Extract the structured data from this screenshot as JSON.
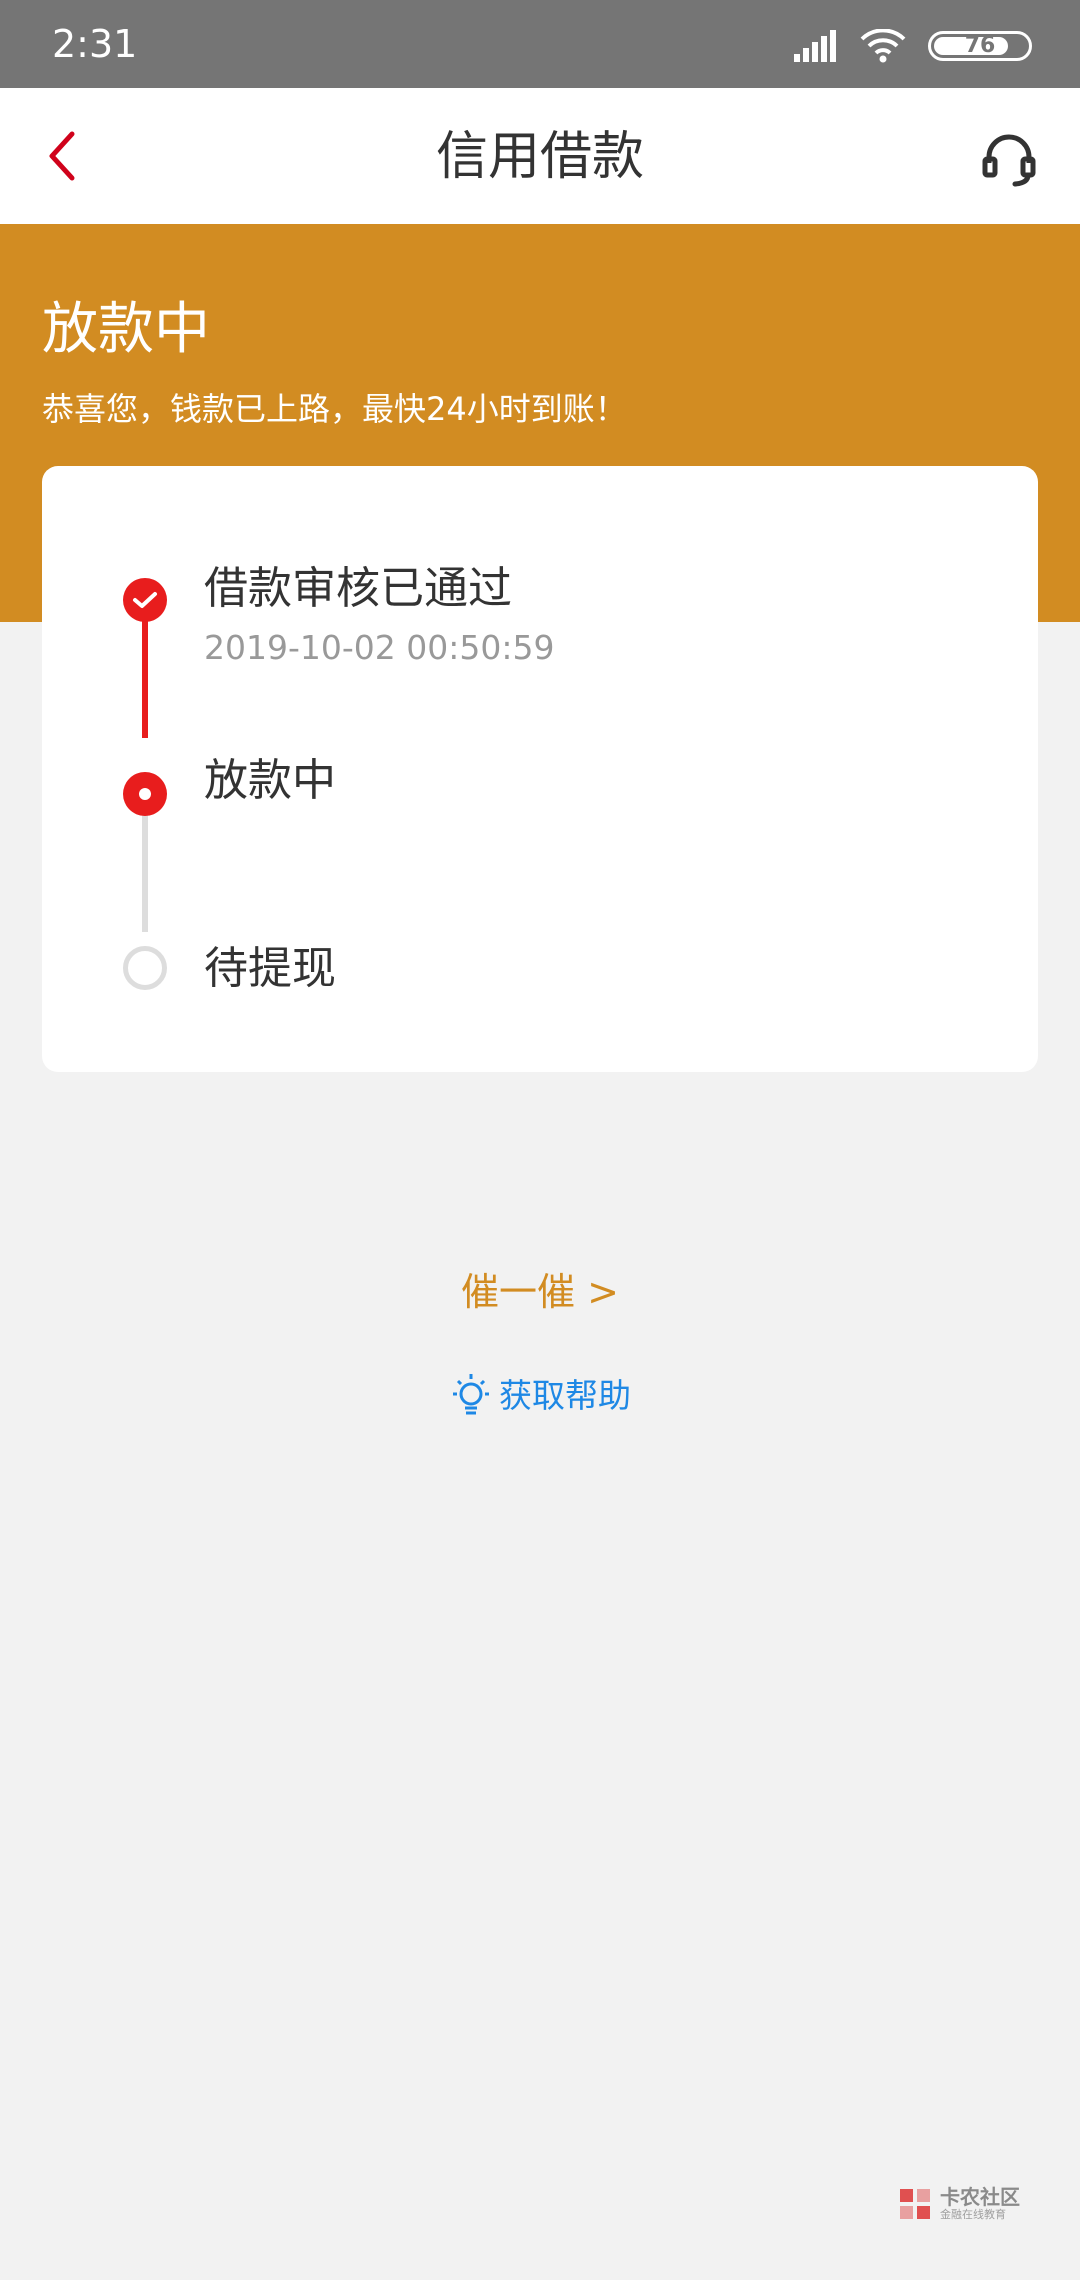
{
  "status_bar": {
    "time": "2:31",
    "battery": "76"
  },
  "nav": {
    "title": "信用借款"
  },
  "banner": {
    "title": "放款中",
    "subtitle": "恭喜您，钱款已上路，最快24小时到账！",
    "color": "#d28c22"
  },
  "steps": [
    {
      "label": "借款审核已通过",
      "time": "2019-10-02 00:50:59",
      "state": "done"
    },
    {
      "label": "放款中",
      "state": "current"
    },
    {
      "label": "待提现",
      "state": "pending"
    }
  ],
  "actions": {
    "urge": "催一催 >",
    "help": "获取帮助"
  },
  "watermark": {
    "main": "卡农社区",
    "sub": "金融在线教育"
  },
  "colors": {
    "accent_red": "#e81d1d",
    "link_blue": "#1e88e5",
    "background": "#f2f2f2"
  }
}
